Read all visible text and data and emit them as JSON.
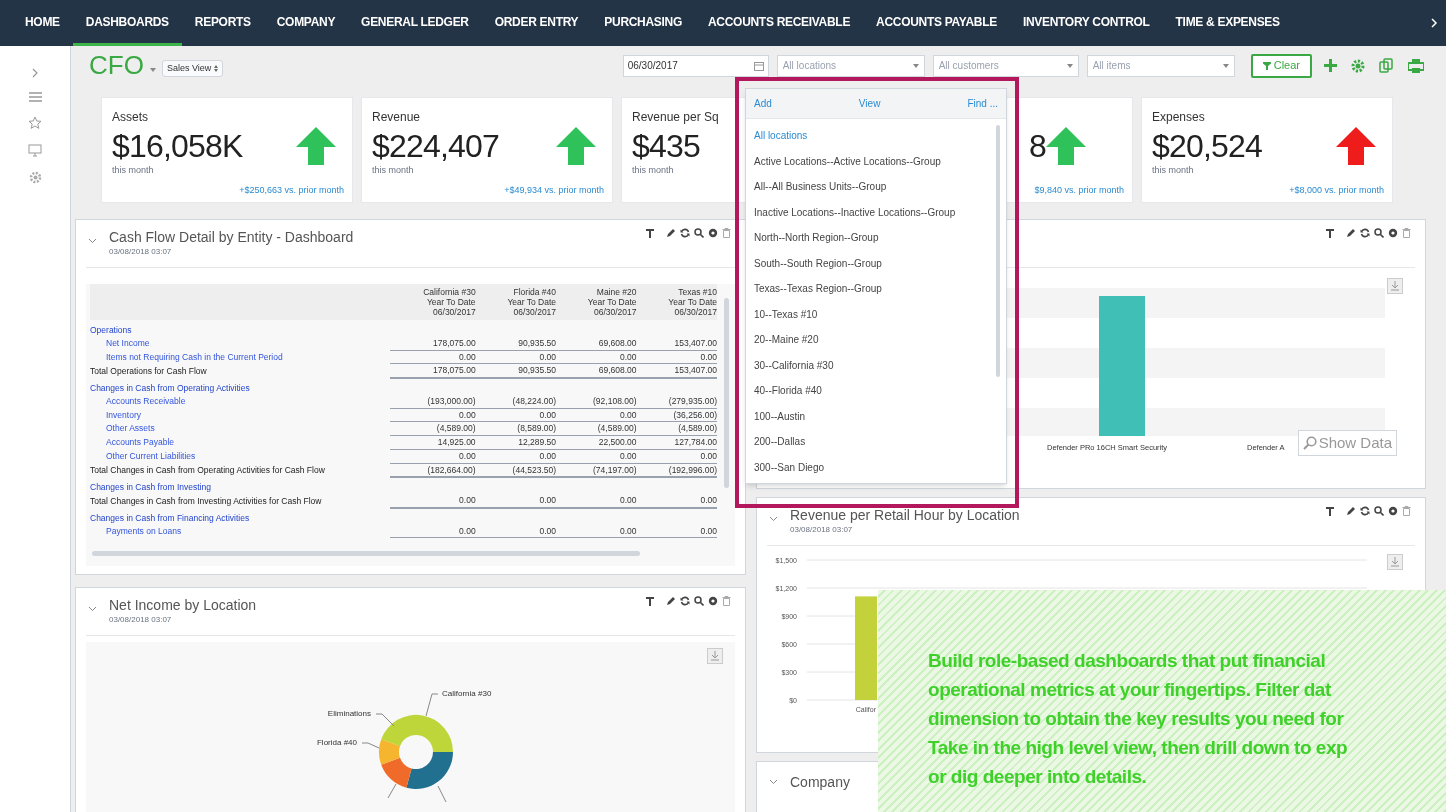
{
  "nav": {
    "items": [
      {
        "label": "HOME",
        "selected": false
      },
      {
        "label": "DASHBOARDS",
        "selected": true
      },
      {
        "label": "REPORTS",
        "selected": false
      },
      {
        "label": "COMPANY",
        "selected": false
      },
      {
        "label": "GENERAL LEDGER",
        "selected": false
      },
      {
        "label": "ORDER ENTRY",
        "selected": false
      },
      {
        "label": "PURCHASING",
        "selected": false
      },
      {
        "label": "ACCOUNTS RECEIVABLE",
        "selected": false
      },
      {
        "label": "ACCOUNTS PAYABLE",
        "selected": false
      },
      {
        "label": "INVENTORY CONTROL",
        "selected": false
      },
      {
        "label": "TIME & EXPENSES",
        "selected": false
      }
    ]
  },
  "header": {
    "title": "CFO",
    "view_select": "Sales View",
    "date": "06/30/2017",
    "location_placeholder": "All locations",
    "customer_placeholder": "All customers",
    "item_placeholder": "All items",
    "clear_button": "Clear"
  },
  "kpis": [
    {
      "label": "Assets",
      "value": "$16,058K",
      "period": "this month",
      "delta": "+$250,663 vs. prior month",
      "rising": true,
      "favorable": true
    },
    {
      "label": "Revenue",
      "value": "$224,407",
      "period": "this month",
      "delta": "+$49,934 vs. prior month",
      "rising": true,
      "favorable": true
    },
    {
      "label": "Revenue per Sq",
      "value": "$435",
      "period": "this month"
    },
    {
      "value": "8",
      "delta": "$9,840 vs. prior month",
      "rising": true,
      "favorable": true
    },
    {
      "label": "Expenses",
      "value": "$20,524",
      "period": "this month",
      "delta": "+$8,000 vs. prior month",
      "rising": true,
      "favorable": false
    }
  ],
  "location_dropdown": {
    "actions": [
      "Add",
      "View",
      "Find ..."
    ],
    "options": [
      {
        "label": "All locations",
        "selected": true
      },
      {
        "label": "Active Locations--Active Locations--Group",
        "selected": false
      },
      {
        "label": "All--All Business Units--Group",
        "selected": false
      },
      {
        "label": "Inactive Locations--Inactive Locations--Group",
        "selected": false
      },
      {
        "label": "North--North Region--Group",
        "selected": false
      },
      {
        "label": "South--South Region--Group",
        "selected": false
      },
      {
        "label": "Texas--Texas Region--Group",
        "selected": false
      },
      {
        "label": "10--Texas #10",
        "selected": false
      },
      {
        "label": "20--Maine #20",
        "selected": false
      },
      {
        "label": "30--California #30",
        "selected": false
      },
      {
        "label": "40--Florida #40",
        "selected": false
      },
      {
        "label": "100--Austin",
        "selected": false
      },
      {
        "label": "200--Dallas",
        "selected": false
      },
      {
        "label": "300--San Diego",
        "selected": false
      }
    ]
  },
  "cash_flow_panel": {
    "title": "Cash Flow Detail by Entity - Dashboard",
    "timestamp": "03/08/2018 03:07",
    "columns": [
      [
        "California #30",
        "Year To Date",
        "06/30/2017"
      ],
      [
        "Florida #40",
        "Year To Date",
        "06/30/2017"
      ],
      [
        "Maine #20",
        "Year To Date",
        "06/30/2017"
      ],
      [
        "Texas #10",
        "Year To Date",
        "06/30/2017"
      ]
    ],
    "rows": [
      {
        "kind": "section",
        "label": "Operations"
      },
      {
        "kind": "item",
        "label": "Net Income",
        "values": [
          "178,075.00",
          "90,935.50",
          "69,608.00",
          "153,407.00"
        ]
      },
      {
        "kind": "item",
        "label": "Items not Requiring Cash in the Current Period",
        "values": [
          "0.00",
          "0.00",
          "0.00",
          "0.00"
        ]
      },
      {
        "kind": "total",
        "label": "Total Operations for Cash Flow",
        "values": [
          "178,075.00",
          "90,935.50",
          "69,608.00",
          "153,407.00"
        ]
      },
      {
        "kind": "section",
        "label": "Changes in Cash from Operating Activities"
      },
      {
        "kind": "item",
        "label": "Accounts Receivable",
        "values": [
          "(193,000.00)",
          "(48,224.00)",
          "(92,108.00)",
          "(279,935.00)"
        ]
      },
      {
        "kind": "item",
        "label": "Inventory",
        "values": [
          "0.00",
          "0.00",
          "0.00",
          "(36,256.00)"
        ]
      },
      {
        "kind": "item",
        "label": "Other Assets",
        "values": [
          "(4,589.00)",
          "(8,589.00)",
          "(4,589.00)",
          "(4,589.00)"
        ]
      },
      {
        "kind": "item",
        "label": "Accounts Payable",
        "values": [
          "14,925.00",
          "12,289.50",
          "22,500.00",
          "127,784.00"
        ]
      },
      {
        "kind": "item",
        "label": "Other Current Liabilities",
        "values": [
          "0.00",
          "0.00",
          "0.00",
          "0.00"
        ]
      },
      {
        "kind": "total",
        "label": "Total Changes in Cash from Operating Activities for Cash Flow",
        "values": [
          "(182,664.00)",
          "(44,523.50)",
          "(74,197.00)",
          "(192,996.00)"
        ]
      },
      {
        "kind": "section",
        "label": "Changes in Cash from Investing"
      },
      {
        "kind": "total",
        "label": "Total Changes in Cash from Investing Activities for Cash Flow",
        "values": [
          "0.00",
          "0.00",
          "0.00",
          "0.00"
        ]
      },
      {
        "kind": "section",
        "label": "Changes in Cash from Financing Activities"
      },
      {
        "kind": "item",
        "label": "Payments on Loans",
        "values": [
          "0.00",
          "0.00",
          "0.00",
          "0.00"
        ]
      }
    ]
  },
  "product_chart_panel": {
    "category_labels": [
      "Defender PRo 16CH Smart Security",
      "Defender A"
    ],
    "show_data_button": "Show Data"
  },
  "revenue_panel": {
    "title": "Revenue per Retail Hour by Location",
    "timestamp": "03/08/2018 03:07",
    "chart_data": {
      "type": "bar",
      "grid": true,
      "categories": [
        "Califor"
      ],
      "ylim": [
        0,
        1500
      ],
      "yticks": [
        {
          "value": 0,
          "label": "$0"
        },
        {
          "value": 300,
          "label": "$300"
        },
        {
          "value": 600,
          "label": "$600"
        },
        {
          "value": 900,
          "label": "$900"
        },
        {
          "value": 1200,
          "label": "$1,200"
        },
        {
          "value": 1500,
          "label": "$1,500"
        }
      ],
      "values": [
        1110
      ]
    }
  },
  "net_income_panel": {
    "title": "Net Income by Location",
    "timestamp": "03/08/2018 03:07",
    "slice_labels": [
      "California #30",
      "Eliminations",
      "Florida #40"
    ]
  },
  "company_panel": {
    "title": "Company"
  },
  "callout": {
    "lines": [
      "Build role-based dashboards that put financial",
      "operational metrics at your fingertips. Filter dat",
      "dimension to obtain the key results you need for",
      "Take in the high level view, then drill down to exp",
      "or dig deeper into details."
    ]
  }
}
